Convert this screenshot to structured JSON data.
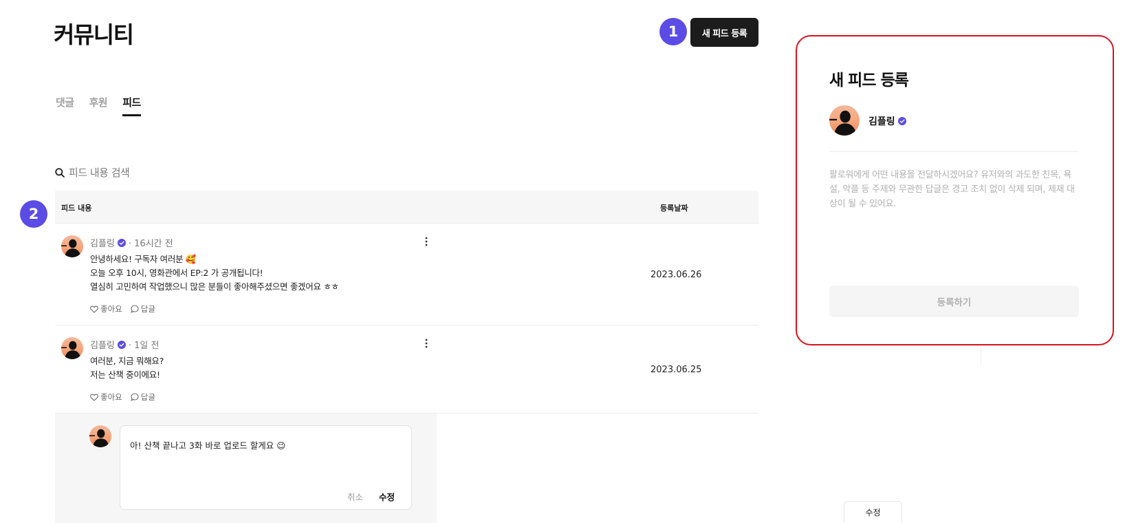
{
  "page": {
    "title": "커뮤니티"
  },
  "badges": {
    "one": "1",
    "two": "2"
  },
  "header": {
    "new_feed_label": "새 피드 등록"
  },
  "tabs": [
    {
      "label": "댓글",
      "active": false
    },
    {
      "label": "후원",
      "active": false
    },
    {
      "label": "피드",
      "active": true
    }
  ],
  "search": {
    "placeholder": "피드 내용 검색"
  },
  "table": {
    "columns": {
      "content": "피드 내용",
      "date": "등록날짜"
    },
    "rows": [
      {
        "author": "김플링",
        "time": "· 16시간 전",
        "lines": [
          "안녕하세요! 구독자 여러분 🥰",
          "오늘 오후 10시, 영화관에서 EP:2 가 공개됩니다!",
          "열심히 고민하여 작업했으니 많은 분들이 좋아해주셨으면 좋겠어요 ㅎㅎ"
        ],
        "like_label": "좋아요",
        "reply_label": "답글",
        "date": "2023.06.26"
      },
      {
        "author": "김플링",
        "time": "· 1일 전",
        "lines": [
          "여러분, 지금 뭐해요?",
          "저는 산책 중이에요!"
        ],
        "like_label": "좋아요",
        "reply_label": "답글",
        "date": "2023.06.25"
      }
    ]
  },
  "reply_editor": {
    "text": "아! 산책 끝나고 3화 바로 업로드 할게요 😉",
    "cancel_label": "취소",
    "edit_label": "수정"
  },
  "bottom": {
    "edit_label": "수정"
  },
  "panel": {
    "title": "새 피드 등록",
    "user": "김플링",
    "placeholder": "팔로워에게 어떤 내용을 전달하시겠어요? 유저와의 과도한 친목, 욕설, 악플 등 주제와 무관한 답글은 경고 조치 없이 삭제 되며, 제재 대상이 될 수 있어요.",
    "submit_label": "등록하기"
  },
  "colors": {
    "accent": "#5b4ce6",
    "panel_border": "#d9121f",
    "dark_button": "#1c1c1c"
  }
}
